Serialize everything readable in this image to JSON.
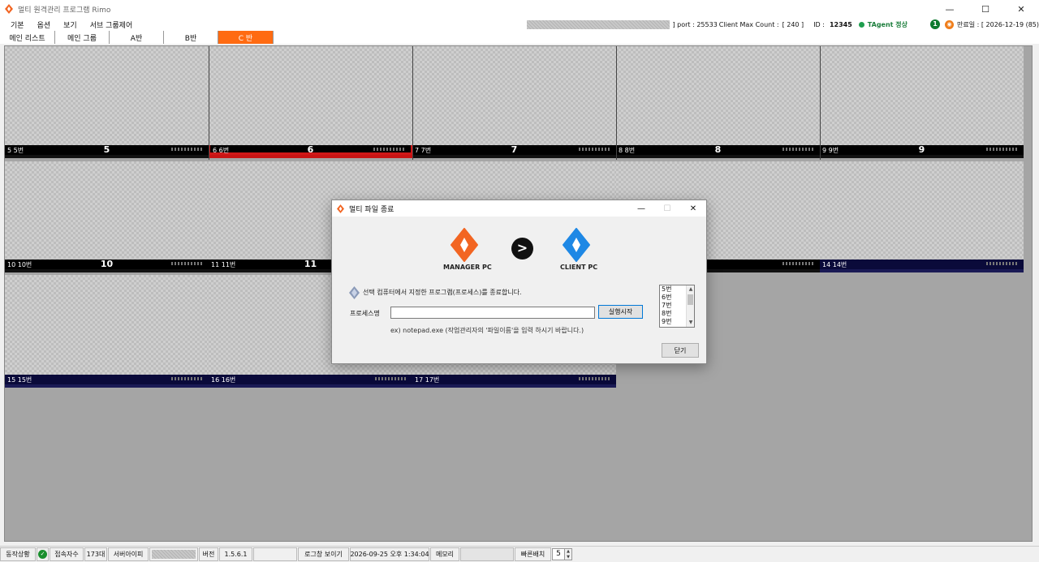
{
  "window": {
    "title": "멀티 원격관리 프로그램 Rimo",
    "controls": [
      "—",
      "☐",
      "✕"
    ]
  },
  "menu": [
    "기본",
    "옵션",
    "보기",
    "서브 그룹제어"
  ],
  "info": {
    "port_text": "] port : 25533",
    "client_max_label": "Client Max Count :",
    "client_max_value": "[ 240 ]",
    "id_label": "ID :",
    "id_value": "12345",
    "agent_status": "TAgent 정상",
    "badge_count": "1",
    "rss_icon": "rss-icon",
    "expiry": "만료일 : [ 2026-12-19 (85)"
  },
  "tabs": [
    {
      "label": "메인 리스트",
      "selected": false
    },
    {
      "label": "메인 그룹",
      "selected": false
    },
    {
      "label": "A반",
      "selected": false
    },
    {
      "label": "B반",
      "selected": false
    },
    {
      "label": "C 반",
      "selected": true
    }
  ],
  "clients": [
    {
      "label": "5 5번",
      "number": "5",
      "bar": "black"
    },
    {
      "label": "6 6번",
      "number": "6",
      "bar": "red"
    },
    {
      "label": "7 7번",
      "number": "7",
      "bar": "black"
    },
    {
      "label": "8 8번",
      "number": "8",
      "bar": "black"
    },
    {
      "label": "9 9번",
      "number": "9",
      "bar": "black"
    },
    {
      "label": "10 10번",
      "number": "10",
      "bar": "black"
    },
    {
      "label": "11 11번",
      "number": "11",
      "bar": "black"
    },
    {
      "label": "",
      "number": "",
      "bar": "black"
    },
    {
      "label": "",
      "number": "",
      "bar": "black"
    },
    {
      "label": "14 14번",
      "number": "",
      "bar": "blue"
    },
    {
      "label": "15 15번",
      "number": "",
      "bar": "blue"
    },
    {
      "label": "16 16번",
      "number": "",
      "bar": "blue"
    },
    {
      "label": "17 17번",
      "number": "",
      "bar": "blue"
    }
  ],
  "dialog": {
    "title": "멀티 파일 종료",
    "manager_caption": "MANAGER PC",
    "client_caption": "CLIENT PC",
    "arrow_glyph": ">",
    "description": "선택 컴퓨터에서 지정한 프로그램(프로세스)를 종료합니다.",
    "process_label": "프로세스명",
    "process_value": "",
    "run_button": "실행시작",
    "example": "ex) notepad.exe (작업관리자의 '파일이름'을 입력 하시기 바랍니다.)",
    "close_button": "닫기",
    "list_items": [
      "5번",
      "6번",
      "7번",
      "8번",
      "9번"
    ],
    "colors": {
      "manager": "#f26522",
      "client": "#1e88e5"
    }
  },
  "status": {
    "state_label": "동작상황",
    "conn_label": "접속자수",
    "conn_value": "173대",
    "server_ip_label": "서버아이피",
    "version_label": "버전",
    "version_value": "1.5.6.1",
    "log_button": "로그창 보이기",
    "datetime": "2026-09-25 오후 1:34:04",
    "memory_label": "메모리",
    "fast_label": "빠른배치",
    "fast_value": "5"
  }
}
